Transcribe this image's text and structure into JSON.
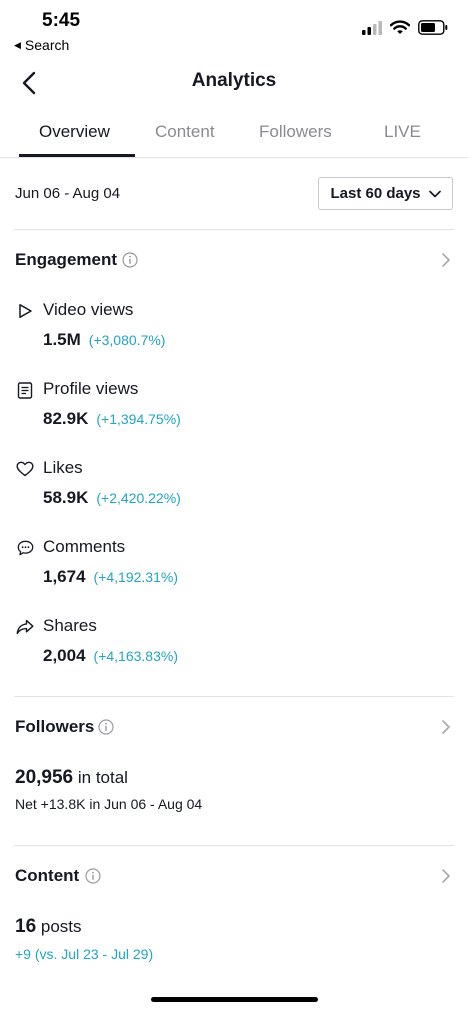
{
  "status_bar": {
    "time": "5:45",
    "back_label": "Search"
  },
  "nav": {
    "title": "Analytics"
  },
  "tabs": [
    {
      "label": "Overview",
      "active": true
    },
    {
      "label": "Content",
      "active": false
    },
    {
      "label": "Followers",
      "active": false
    },
    {
      "label": "LIVE",
      "active": false
    }
  ],
  "date_range": "Jun 06 - Aug 04",
  "period_select": {
    "value": "Last 60 days"
  },
  "engagement": {
    "title": "Engagement",
    "metrics": [
      {
        "icon": "play-icon",
        "label": "Video views",
        "value": "1.5M",
        "change": "(+3,080.7%)"
      },
      {
        "icon": "profile-card-icon",
        "label": "Profile views",
        "value": "82.9K",
        "change": "(+1,394.75%)"
      },
      {
        "icon": "heart-icon",
        "label": "Likes",
        "value": "58.9K",
        "change": "(+2,420.22%)"
      },
      {
        "icon": "comment-icon",
        "label": "Comments",
        "value": "1,674",
        "change": "(+4,192.31%)"
      },
      {
        "icon": "share-icon",
        "label": "Shares",
        "value": "2,004",
        "change": "(+4,163.83%)"
      }
    ]
  },
  "followers": {
    "title": "Followers",
    "total": "20,956",
    "total_suffix": "in total",
    "net": "Net +13.8K in Jun 06 - Aug 04"
  },
  "content": {
    "title": "Content",
    "posts": "16",
    "posts_suffix": "posts",
    "change": "+9 (vs. Jul 23 - Jul 29)"
  },
  "colors": {
    "accent_teal": "#20a5c5",
    "text": "#161823",
    "muted": "#8a8b91"
  }
}
